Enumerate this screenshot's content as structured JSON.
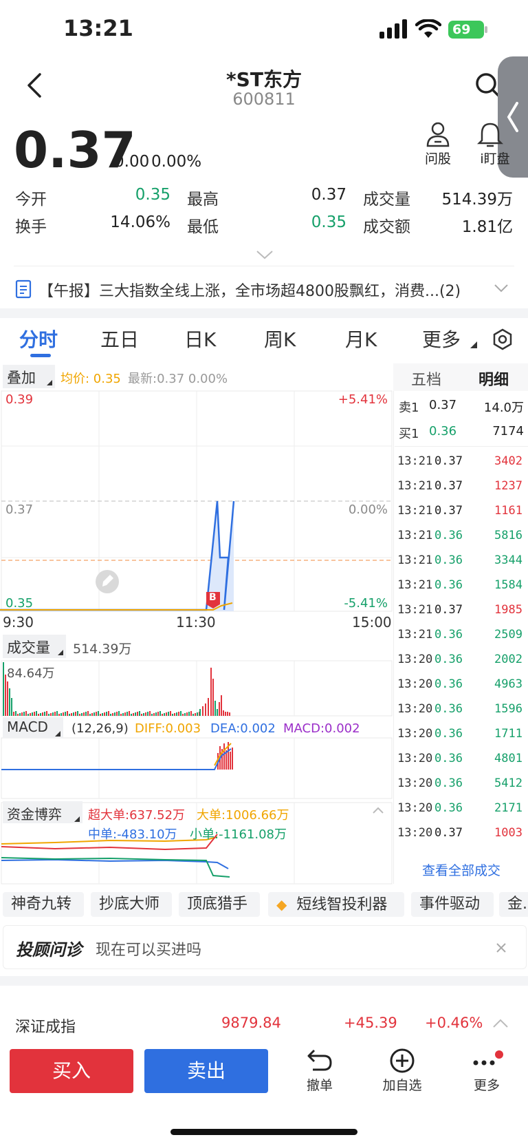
{
  "status_bar": {
    "time": "13:21",
    "battery": "69"
  },
  "header": {
    "name": "*ST东方",
    "code": "600811"
  },
  "quote": {
    "price": "0.37",
    "change": "0.00",
    "change_pct": "0.00%",
    "actions": [
      {
        "label": "问股",
        "icon": "person-icon"
      },
      {
        "label": "i盯盘",
        "icon": "bell-icon"
      }
    ]
  },
  "stats": [
    [
      {
        "label": "今开",
        "value": "0.35",
        "color": "#16a06a"
      },
      {
        "label": "最高",
        "value": "0.37",
        "color": "#222222"
      },
      {
        "label": "成交量",
        "value": "514.39万",
        "color": "#222222"
      }
    ],
    [
      {
        "label": "换手",
        "value": "14.06%",
        "color": "#222222"
      },
      {
        "label": "最低",
        "value": "0.35",
        "color": "#16a06a"
      },
      {
        "label": "成交额",
        "value": "1.81亿",
        "color": "#222222"
      }
    ]
  ],
  "news": {
    "text": "【午报】三大指数全线上涨，全市场超4800股飘红，消费...(2)"
  },
  "chart_tabs": [
    "分时",
    "五日",
    "日K",
    "周K",
    "月K",
    "更多"
  ],
  "active_tab": "分时",
  "overlay": {
    "label": "叠加",
    "avg": "均价: 0.35",
    "latest": "最新:0.37 0.00%"
  },
  "price_axis": {
    "top": "0.39",
    "mid": "0.37",
    "bottom": "0.35",
    "top_pct": "+5.41%",
    "mid_pct": "0.00%",
    "bottom_pct": "-5.41%"
  },
  "time_axis": [
    "9:30",
    "11:30",
    "15:00"
  ],
  "marker": "B",
  "volume": {
    "label": "成交量",
    "total": "514.39万",
    "max": "84.64万"
  },
  "macd": {
    "label": "MACD",
    "params": "(12,26,9)",
    "diff": "DIFF:0.003",
    "dea": "DEA:0.002",
    "macd": "MACD:0.002"
  },
  "fund": {
    "label": "资金博弈",
    "super": "超大单:637.52万",
    "large": "大单:1006.66万",
    "mid": "中单:-483.10万",
    "small": "小单:-1161.08万"
  },
  "side_tabs": [
    "五档",
    "明细"
  ],
  "orderbook": [
    {
      "side": "卖1",
      "price": "0.37",
      "volume": "14.0万"
    },
    {
      "side": "买1",
      "price": "0.36",
      "volume": "7174"
    }
  ],
  "trades": [
    {
      "time": "13:21",
      "price": "0.37",
      "vol": "3402",
      "pc": "#222222",
      "vc": "#e2333c"
    },
    {
      "time": "13:21",
      "price": "0.37",
      "vol": "1237",
      "pc": "#222222",
      "vc": "#e2333c"
    },
    {
      "time": "13:21",
      "price": "0.37",
      "vol": "1161",
      "pc": "#222222",
      "vc": "#e2333c"
    },
    {
      "time": "13:21",
      "price": "0.36",
      "vol": "5816",
      "pc": "#16a06a",
      "vc": "#16a06a"
    },
    {
      "time": "13:21",
      "price": "0.36",
      "vol": "3344",
      "pc": "#16a06a",
      "vc": "#16a06a"
    },
    {
      "time": "13:21",
      "price": "0.36",
      "vol": "1584",
      "pc": "#16a06a",
      "vc": "#16a06a"
    },
    {
      "time": "13:21",
      "price": "0.37",
      "vol": "1985",
      "pc": "#222222",
      "vc": "#e2333c"
    },
    {
      "time": "13:21",
      "price": "0.36",
      "vol": "2509",
      "pc": "#16a06a",
      "vc": "#16a06a"
    },
    {
      "time": "13:20",
      "price": "0.36",
      "vol": "2002",
      "pc": "#16a06a",
      "vc": "#16a06a"
    },
    {
      "time": "13:20",
      "price": "0.36",
      "vol": "4963",
      "pc": "#16a06a",
      "vc": "#16a06a"
    },
    {
      "time": "13:20",
      "price": "0.36",
      "vol": "1596",
      "pc": "#16a06a",
      "vc": "#16a06a"
    },
    {
      "time": "13:20",
      "price": "0.36",
      "vol": "1711",
      "pc": "#16a06a",
      "vc": "#16a06a"
    },
    {
      "time": "13:20",
      "price": "0.36",
      "vol": "4801",
      "pc": "#16a06a",
      "vc": "#16a06a"
    },
    {
      "time": "13:20",
      "price": "0.36",
      "vol": "5412",
      "pc": "#16a06a",
      "vc": "#16a06a"
    },
    {
      "time": "13:20",
      "price": "0.36",
      "vol": "2171",
      "pc": "#16a06a",
      "vc": "#16a06a"
    },
    {
      "time": "13:20",
      "price": "0.37",
      "vol": "1003",
      "pc": "#222222",
      "vc": "#e2333c"
    }
  ],
  "see_all": "查看全部成交",
  "strategies": [
    "神奇九转",
    "抄底大师",
    "顶底猎手",
    "短线智投利器",
    "事件驱动",
    "金..."
  ],
  "advisor": {
    "logo": "投顾问诊",
    "text": "现在可以买进吗"
  },
  "index": {
    "name": "深证成指",
    "value": "9879.84",
    "change": "+45.39",
    "pct": "+0.46%"
  },
  "bottom_bar": {
    "buy": "买入",
    "sell": "卖出",
    "cancel": "撤单",
    "watch": "加自选",
    "more": "更多"
  }
}
